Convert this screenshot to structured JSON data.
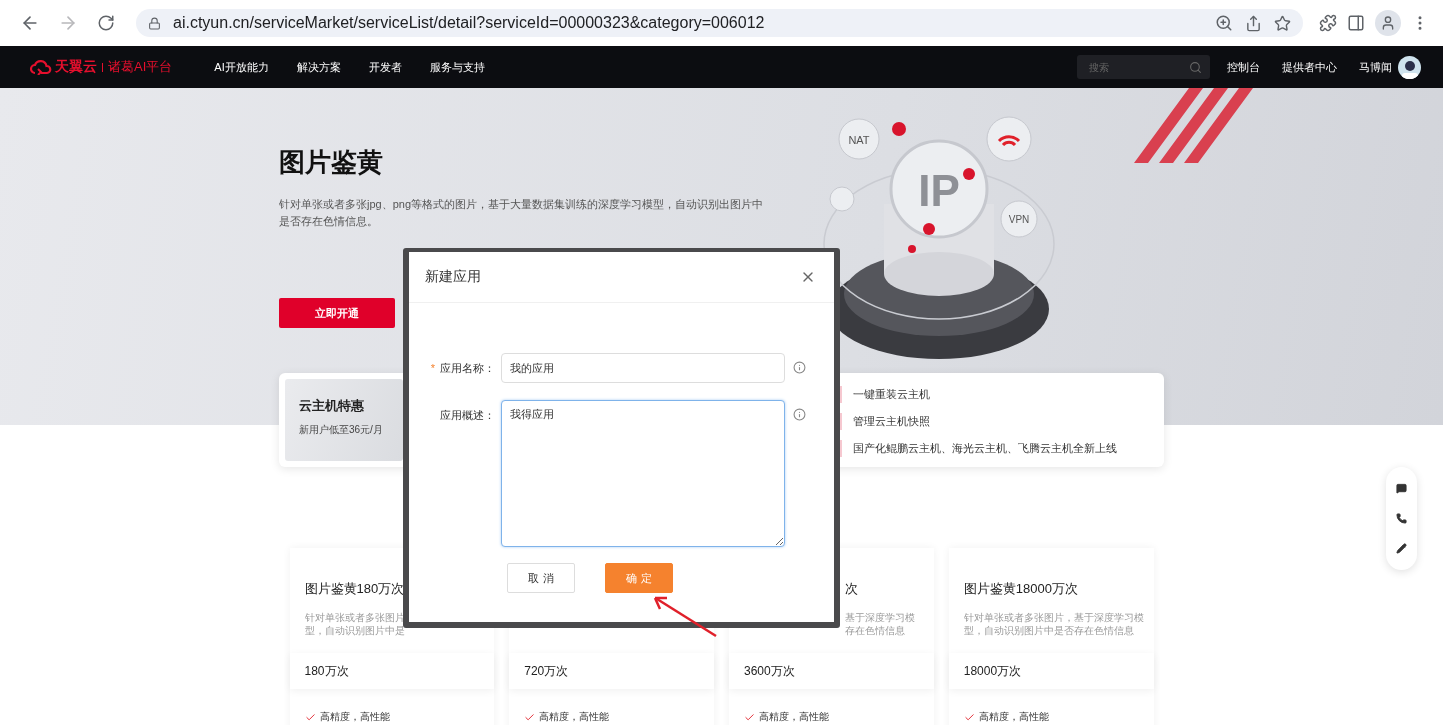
{
  "browser": {
    "url": "ai.ctyun.cn/serviceMarket/serviceList/detail?serviceId=00000323&category=006012",
    "forward_disabled": true
  },
  "nav": {
    "brand": "天翼云",
    "platform": "诸葛AI平台",
    "links": [
      "AI开放能力",
      "解决方案",
      "开发者",
      "服务与支持"
    ],
    "search": {
      "placeholder": "搜索"
    },
    "right_links": [
      "控制台",
      "提供者中心"
    ],
    "user": "马博闻"
  },
  "hero": {
    "title": "图片鉴黄",
    "description": "针对单张或者多张jpg、png等格式的图片，基于大量数据集训练的深度学习模型，自动识别出图片中是否存在色情信息。",
    "button": "立即开通",
    "illustration_labels": [
      "NAT",
      "IP",
      "VPN"
    ]
  },
  "promo": {
    "title": "云主机特惠",
    "subtitle": "新用户低至36元/月",
    "items": [
      "一键重装云主机",
      "管理云主机快照",
      "国产化鲲鹏云主机、海光云主机、飞腾云主机全新上线"
    ]
  },
  "plans": [
    {
      "kind": "plain",
      "title": "图片鉴黄180万次",
      "desc_lines": [
        "针对单张或者多张图片",
        "型，自动识别图片中是"
      ],
      "price": "180万次",
      "feature": "高精度，高性能"
    },
    {
      "kind": "plain",
      "price": "720万次",
      "feature": "高精度，高性能"
    },
    {
      "kind": "clipped",
      "title": "次",
      "desc_lines": [
        "基于深度学习模",
        "存在色情信息"
      ],
      "price": "3600万次",
      "feature": "高精度，高性能"
    },
    {
      "kind": "plain",
      "title": "图片鉴黄18000万次",
      "desc_lines": [
        "针对单张或者多张图片，基于深度学习模",
        "型，自动识别图片中是否存在色情信息"
      ],
      "price": "18000万次",
      "feature": "高精度，高性能"
    }
  ],
  "modal": {
    "title": "新建应用",
    "fields": [
      {
        "kind": "input",
        "label": "应用名称：",
        "required": true,
        "required_mark": "*",
        "value": "我的应用",
        "focused": false
      },
      {
        "kind": "textarea",
        "label": "应用概述：",
        "required": false,
        "value": "我得应用",
        "focused": true
      }
    ],
    "buttons": [
      {
        "kind": "default",
        "label": "取 消"
      },
      {
        "kind": "primary",
        "label": "确 定"
      }
    ]
  }
}
